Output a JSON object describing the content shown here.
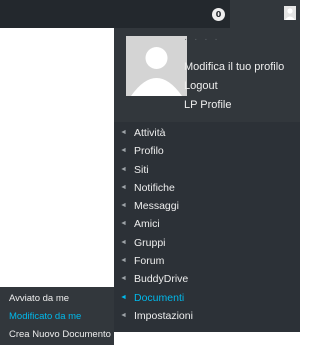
{
  "adminbar": {
    "notification_count": "0"
  },
  "account": {
    "dots": "· · · ·",
    "avatar_icon": "default-user-avatar"
  },
  "profile_links": [
    {
      "label": "Modifica il tuo profilo"
    },
    {
      "label": "Logout"
    },
    {
      "label": "LP Profile"
    }
  ],
  "menu": {
    "arrow_glyph": "◄",
    "items": [
      {
        "label": "Attività"
      },
      {
        "label": "Profilo"
      },
      {
        "label": "Siti"
      },
      {
        "label": "Notifiche"
      },
      {
        "label": "Messaggi"
      },
      {
        "label": "Amici"
      },
      {
        "label": "Gruppi"
      },
      {
        "label": "Forum"
      },
      {
        "label": "BuddyDrive"
      },
      {
        "label": "Documenti",
        "active": true
      },
      {
        "label": "Impostazioni"
      }
    ]
  },
  "submenu": {
    "items": [
      {
        "label": "Avviato da me"
      },
      {
        "label": "Modificato da me",
        "active": true
      },
      {
        "label": "Crea Nuovo Documento"
      }
    ]
  },
  "colors": {
    "bar_bg": "#23282d",
    "dropdown_bg": "#32373c",
    "menu_bg": "#2c3137",
    "text": "#eeeeee",
    "active": "#00b9eb"
  }
}
